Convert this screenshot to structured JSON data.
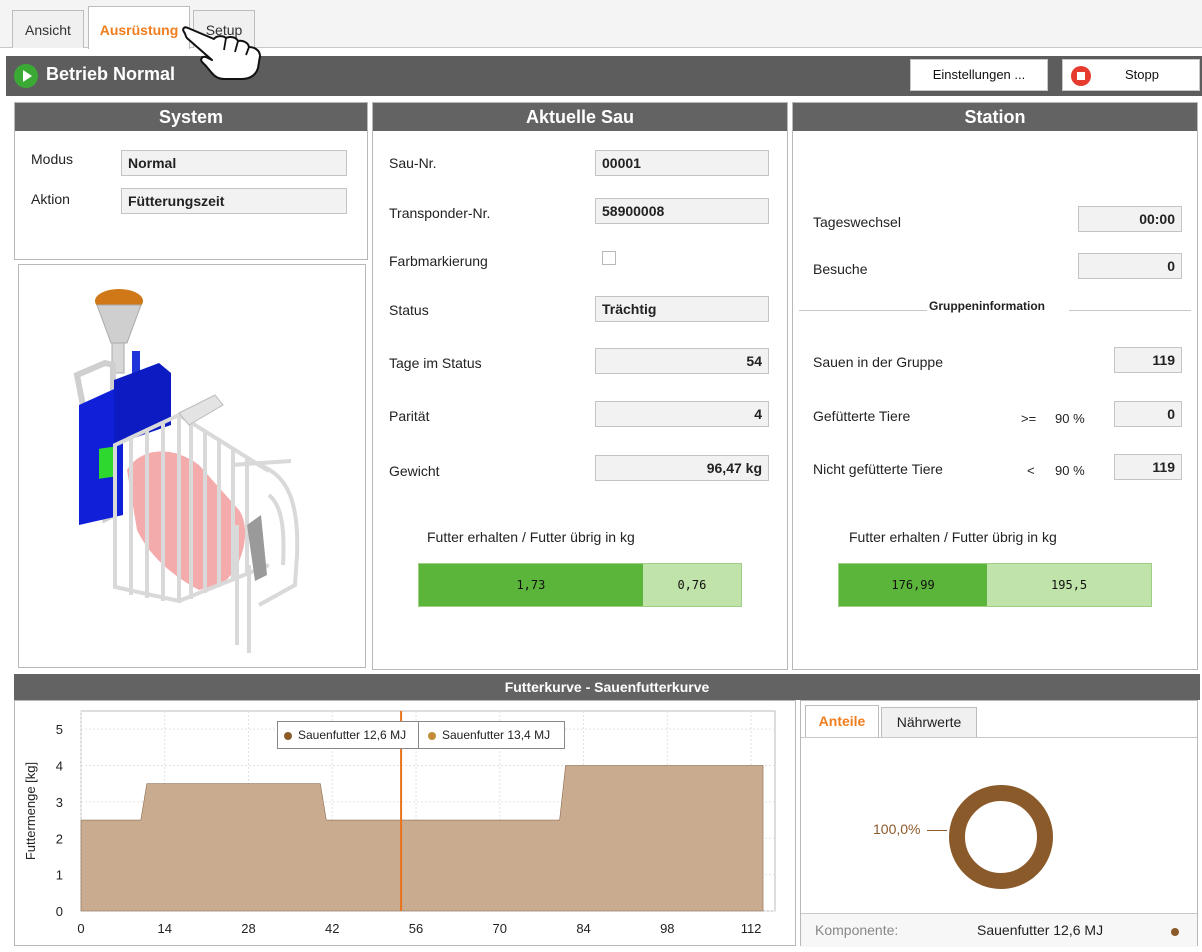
{
  "tabs": [
    {
      "label": "Ansicht",
      "active": false
    },
    {
      "label": "Ausrüstung",
      "active": true
    },
    {
      "label": "Setup",
      "active": false
    }
  ],
  "status": {
    "title": "Betrieb Normal",
    "settings_label": "Einstellungen ...",
    "stop_label": "Stopp"
  },
  "system": {
    "title": "System",
    "mode_label": "Modus",
    "mode_value": "Normal",
    "action_label": "Aktion",
    "action_value": "Fütterungszeit"
  },
  "sow": {
    "title": "Aktuelle Sau",
    "fields": [
      {
        "label": "Sau-Nr.",
        "value": "00001"
      },
      {
        "label": "Transponder-Nr.",
        "value": "58900008"
      },
      {
        "label": "Farbmarkierung",
        "value": ""
      },
      {
        "label": "Status",
        "value": "Trächtig"
      },
      {
        "label": "Tage im Status",
        "value": "54"
      },
      {
        "label": "Parität",
        "value": "4"
      },
      {
        "label": "Gewicht",
        "value": "96,47 kg"
      }
    ],
    "feed_caption": "Futter erhalten / Futter übrig in  kg",
    "feed_received": "1,73",
    "feed_left": "0,76",
    "feed_fraction": 0.695
  },
  "station": {
    "title": "Station",
    "day_change_label": "Tageswechsel",
    "day_change_value": "00:00",
    "visits_label": "Besuche",
    "visits_value": "0",
    "group_heading": "Gruppeninformation",
    "group_rows": [
      {
        "label": "Sauen in der Gruppe",
        "op": "",
        "pct": "",
        "value": "119"
      },
      {
        "label": "Gefütterte Tiere",
        "op": ">=",
        "pct": "90 %",
        "value": "0"
      },
      {
        "label": "Nicht gefütterte Tiere",
        "op": "<",
        "pct": "90 %",
        "value": "119"
      }
    ],
    "feed_caption": "Futter erhalten / Futter übrig in  kg",
    "feed_received": "176,99",
    "feed_left": "195,5",
    "feed_fraction": 0.475
  },
  "curve": {
    "section_title": "Futterkurve - Sauenfutterkurve",
    "pie_tabs": [
      "Anteile",
      "Nährwerte"
    ],
    "pie_label": "100,0%",
    "component_label": "Komponente:",
    "component_value": "Sauenfutter 12,6 MJ"
  },
  "chart_data": {
    "type": "area",
    "ylabel": "Futtermenge [kg]",
    "xlabel": "",
    "xlim": [
      0,
      116
    ],
    "ylim": [
      0,
      5.5
    ],
    "xticks": [
      0,
      14,
      28,
      42,
      56,
      70,
      84,
      98,
      112
    ],
    "yticks": [
      0,
      1,
      2,
      3,
      4,
      5
    ],
    "grid": true,
    "legend": [
      "Sauenfutter 12,6 MJ",
      "Sauenfutter 13,4 MJ"
    ],
    "legend_colors": [
      "#8b5a2b",
      "#c58a3a"
    ],
    "legend_placement": "top-center",
    "marker_x": 53.5,
    "series": [
      {
        "name": "Sauenfutter 12,6 MJ",
        "x": [
          0,
          10,
          11,
          40,
          41,
          80,
          81,
          114
        ],
        "values": [
          2.5,
          2.5,
          3.5,
          3.5,
          2.5,
          2.5,
          4,
          4
        ]
      }
    ],
    "colors": {
      "fill": "#c9ac90",
      "stroke": "#8b6b4e",
      "marker": "#e8731c"
    }
  },
  "pie_chart": {
    "type": "pie",
    "categories": [
      "Sauenfutter 12,6 MJ"
    ],
    "values": [
      100
    ],
    "color": "#8b5a2b"
  }
}
